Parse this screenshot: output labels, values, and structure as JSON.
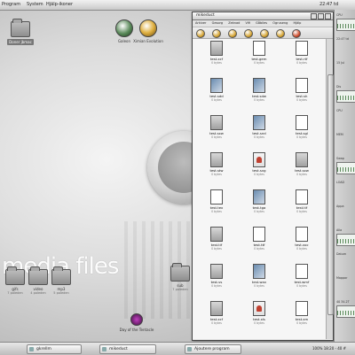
{
  "top_panel": {
    "menu": [
      "Program",
      "System",
      "Hjälp-ikoner"
    ],
    "clock": "22:47 td"
  },
  "desktop": {
    "watermark": "media files",
    "icons": {
      "home": {
        "label": "Doner jbmac"
      },
      "gnome": {
        "label": "Galeon"
      },
      "evolution": {
        "label": "Ximian Evolution"
      },
      "gifs": {
        "label": "gifs",
        "sub": "7 poleden"
      },
      "video": {
        "label": "video",
        "sub": "4 poleden"
      },
      "mp3": {
        "label": "mp3",
        "sub": "5 poleden"
      },
      "day": {
        "label": "Day of the Tentacle"
      },
      "sub_folder": {
        "label": "sub",
        "sub": "7 poleden"
      }
    }
  },
  "window": {
    "title": "mikeduct",
    "menu": [
      "Arkiver",
      "Gesorg",
      "Zeknad",
      "Vifi",
      "Gåbiles",
      "Ogruseng",
      "Hjälp"
    ],
    "files": [
      {
        "name": "test.xcf",
        "size": "0 bytes",
        "type": "dark"
      },
      {
        "name": "test.gem",
        "size": "0 bytes",
        "type": "plain"
      },
      {
        "name": "test.rtf",
        "size": "0 bytes",
        "type": "plain"
      },
      {
        "name": "test.sdd",
        "size": "0 bytes",
        "type": "img"
      },
      {
        "name": "test.sdw",
        "size": "0 bytes",
        "type": "img"
      },
      {
        "name": "test.sh",
        "size": "0 bytes",
        "type": "plain"
      },
      {
        "name": "test.sxw",
        "size": "0 bytes",
        "type": "dark"
      },
      {
        "name": "test.snd",
        "size": "0 bytes",
        "type": "img"
      },
      {
        "name": "test.sgl",
        "size": "0 bytes",
        "type": "plain"
      },
      {
        "name": "test.stw",
        "size": "0 bytes",
        "type": "dark"
      },
      {
        "name": "test.svg",
        "size": "0 bytes",
        "type": "red"
      },
      {
        "name": "test.sxw",
        "size": "0 bytes",
        "type": "dark"
      },
      {
        "name": "test.tex",
        "size": "0 bytes",
        "type": "plain"
      },
      {
        "name": "test.tga",
        "size": "0 bytes",
        "type": "img"
      },
      {
        "name": "test.tif",
        "size": "0 bytes",
        "type": "plain"
      },
      {
        "name": "test.tif",
        "size": "0 bytes",
        "type": "dark"
      },
      {
        "name": "test.ttf",
        "size": "0 bytes",
        "type": "plain"
      },
      {
        "name": "test.voc",
        "size": "0 bytes",
        "type": "plain"
      },
      {
        "name": "test.vs",
        "size": "0 bytes",
        "type": "dark"
      },
      {
        "name": "test.wav",
        "size": "0 bytes",
        "type": "img"
      },
      {
        "name": "test.wmf",
        "size": "0 bytes",
        "type": "plain"
      },
      {
        "name": "test.xcf",
        "size": "0 bytes",
        "type": "dark"
      },
      {
        "name": "test.xls",
        "size": "0 bytes",
        "type": "red"
      },
      {
        "name": "test.xm",
        "size": "0 bytes",
        "type": "plain"
      }
    ]
  },
  "side_panel": {
    "rows": [
      "CPU",
      "22:47 td",
      "15 Jul",
      "Dis",
      "CPU",
      "MEM",
      "Swap",
      "LOAD",
      "Appa",
      "Alla",
      "Datum",
      "Mappar",
      "40 34.2T"
    ]
  },
  "bottom_panel": {
    "tasks": [
      "gkrellm",
      "mikeduct",
      "Ajoutere program"
    ],
    "status": "100% 18:20 - 40 #"
  }
}
